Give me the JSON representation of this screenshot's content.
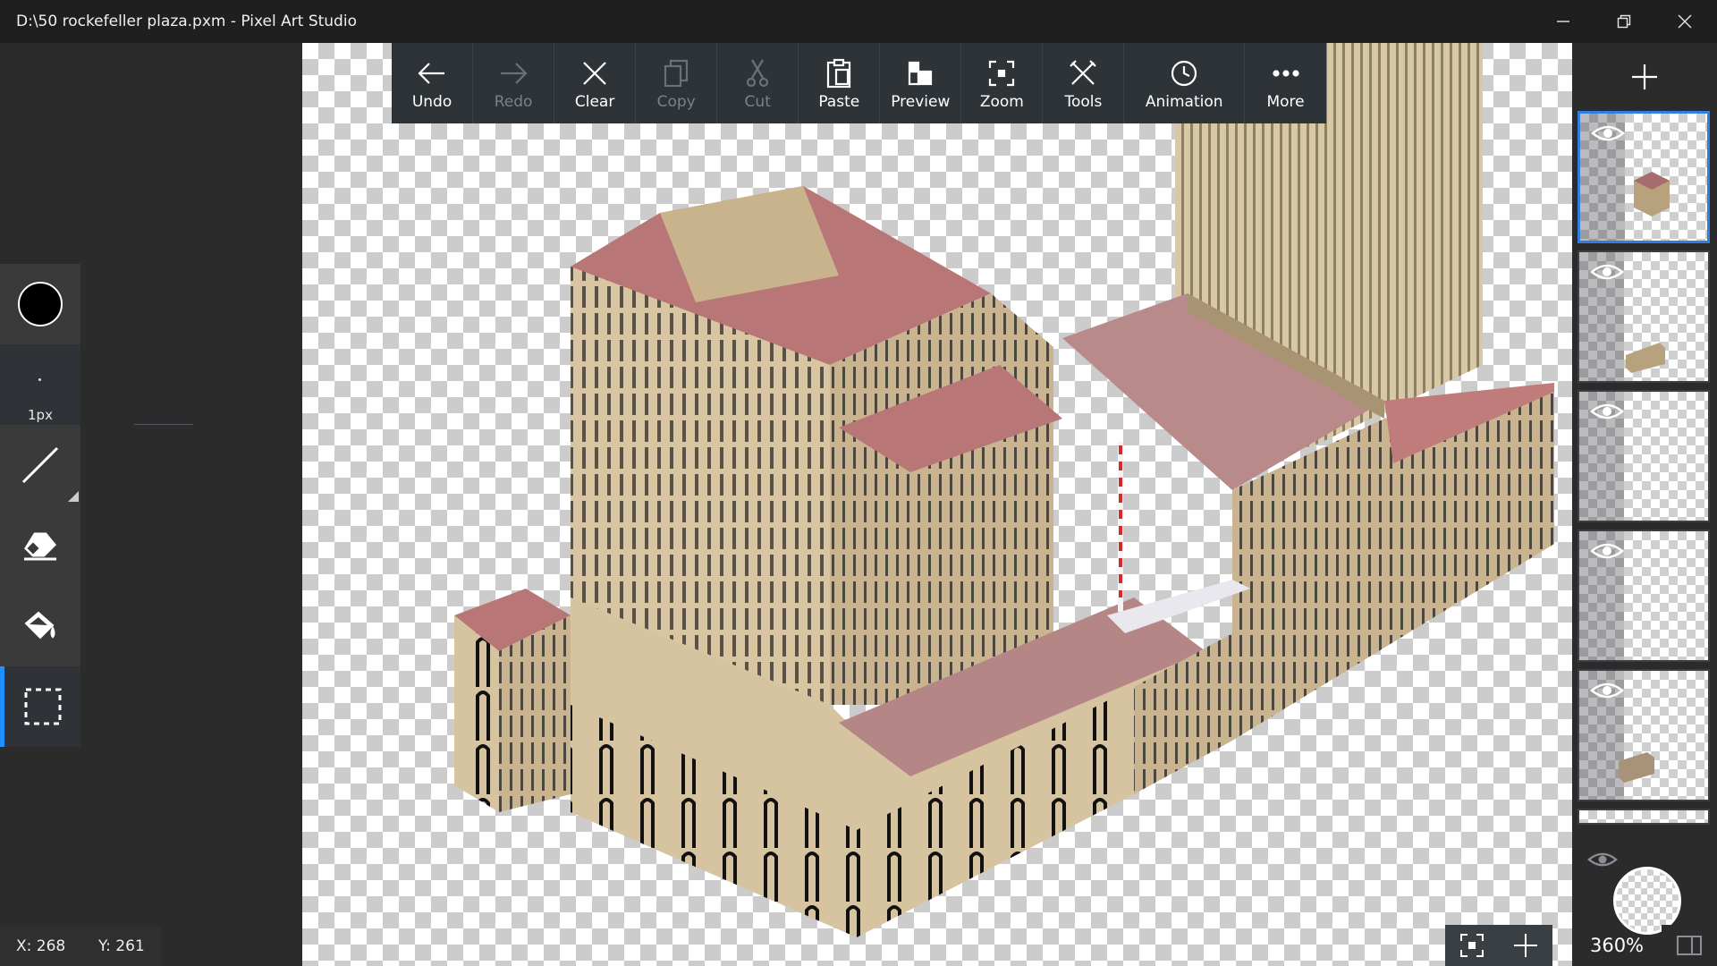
{
  "window": {
    "title": "D:\\50 rockefeller plaza.pxm - Pixel Art Studio"
  },
  "toolbar": {
    "undo": "Undo",
    "redo": "Redo",
    "clear": "Clear",
    "copy": "Copy",
    "cut": "Cut",
    "paste": "Paste",
    "preview": "Preview",
    "zoom": "Zoom",
    "tools": "Tools",
    "animation": "Animation",
    "more": "More"
  },
  "brush": {
    "size_label": "1px",
    "primary_color": "#000000"
  },
  "status": {
    "x": "X: 268",
    "y": "Y: 261",
    "zoom": "360%"
  },
  "colors": {
    "accent": "#2f7fe0",
    "building_wall": "#d6c3a0",
    "building_roof": "#b97676",
    "building_shadow": "#a89372"
  },
  "layers": [
    {
      "visible": true,
      "selected": true
    },
    {
      "visible": true,
      "selected": false
    },
    {
      "visible": true,
      "selected": false
    },
    {
      "visible": true,
      "selected": false
    },
    {
      "visible": true,
      "selected": false
    },
    {
      "visible": true,
      "selected": false
    }
  ]
}
